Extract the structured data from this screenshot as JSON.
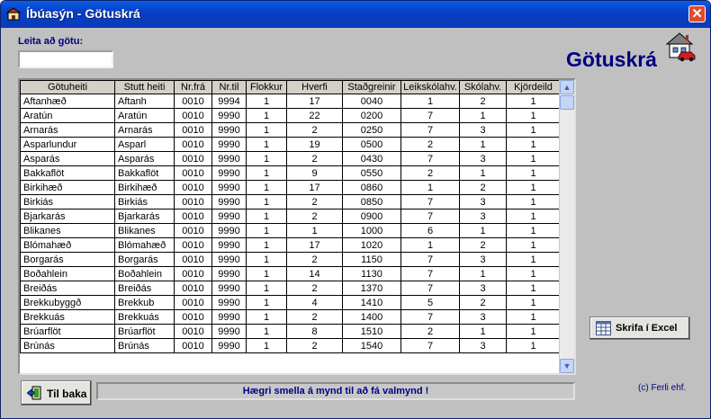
{
  "window": {
    "title": "Íbúasýn - Götuskrá",
    "close_glyph": "✕"
  },
  "search": {
    "label": "Leita að götu:",
    "value": "",
    "placeholder": ""
  },
  "heading": "Götuskrá",
  "table": {
    "columns": [
      "Götuheiti",
      "Stutt heiti",
      "Nr.frá",
      "Nr.til",
      "Flokkur",
      "Hverfi",
      "Staðgreinir",
      "Leikskólahv.",
      "Skólahv.",
      "Kjördeild"
    ],
    "rows": [
      [
        "Aftanhæð",
        "Aftanh",
        "0010",
        "9994",
        "1",
        "17",
        "0040",
        "1",
        "2",
        "1"
      ],
      [
        "Aratún",
        "Aratún",
        "0010",
        "9990",
        "1",
        "22",
        "0200",
        "7",
        "1",
        "1"
      ],
      [
        "Arnarás",
        "Arnarás",
        "0010",
        "9990",
        "1",
        "2",
        "0250",
        "7",
        "3",
        "1"
      ],
      [
        "Asparlundur",
        "Asparl",
        "0010",
        "9990",
        "1",
        "19",
        "0500",
        "2",
        "1",
        "1"
      ],
      [
        "Asparás",
        "Asparás",
        "0010",
        "9990",
        "1",
        "2",
        "0430",
        "7",
        "3",
        "1"
      ],
      [
        "Bakkaflöt",
        "Bakkaflöt",
        "0010",
        "9990",
        "1",
        "9",
        "0550",
        "2",
        "1",
        "1"
      ],
      [
        "Birkihæð",
        "Birkihæð",
        "0010",
        "9990",
        "1",
        "17",
        "0860",
        "1",
        "2",
        "1"
      ],
      [
        "Birkiás",
        "Birkiás",
        "0010",
        "9990",
        "1",
        "2",
        "0850",
        "7",
        "3",
        "1"
      ],
      [
        "Bjarkarás",
        "Bjarkarás",
        "0010",
        "9990",
        "1",
        "2",
        "0900",
        "7",
        "3",
        "1"
      ],
      [
        "Blikanes",
        "Blikanes",
        "0010",
        "9990",
        "1",
        "1",
        "1000",
        "6",
        "1",
        "1"
      ],
      [
        "Blómahæð",
        "Blómahæð",
        "0010",
        "9990",
        "1",
        "17",
        "1020",
        "1",
        "2",
        "1"
      ],
      [
        "Borgarás",
        "Borgarás",
        "0010",
        "9990",
        "1",
        "2",
        "1150",
        "7",
        "3",
        "1"
      ],
      [
        "Boðahlein",
        "Boðahlein",
        "0010",
        "9990",
        "1",
        "14",
        "1130",
        "7",
        "1",
        "1"
      ],
      [
        "Breiðás",
        "Breiðás",
        "0010",
        "9990",
        "1",
        "2",
        "1370",
        "7",
        "3",
        "1"
      ],
      [
        "Brekkubyggð",
        "Brekkub",
        "0010",
        "9990",
        "1",
        "4",
        "1410",
        "5",
        "2",
        "1"
      ],
      [
        "Brekkuás",
        "Brekkuás",
        "0010",
        "9990",
        "1",
        "2",
        "1400",
        "7",
        "3",
        "1"
      ],
      [
        "Brúarflöt",
        "Brúarflöt",
        "0010",
        "9990",
        "1",
        "8",
        "1510",
        "2",
        "1",
        "1"
      ],
      [
        "Brúnás",
        "Brúnás",
        "0010",
        "9990",
        "1",
        "2",
        "1540",
        "7",
        "3",
        "1"
      ]
    ]
  },
  "excel_button": {
    "label": "Skrifa í Excel",
    "icon": "spreadsheet-icon"
  },
  "back_button": {
    "label": "Til baka",
    "icon": "exit-door-icon"
  },
  "status": "Hægri smella á mynd til að fá valmynd !",
  "copyright": "(c) Ferli ehf.",
  "colors": {
    "title_bar": "#0a5ce6",
    "heading": "#000080",
    "background": "#c0c0c0"
  }
}
